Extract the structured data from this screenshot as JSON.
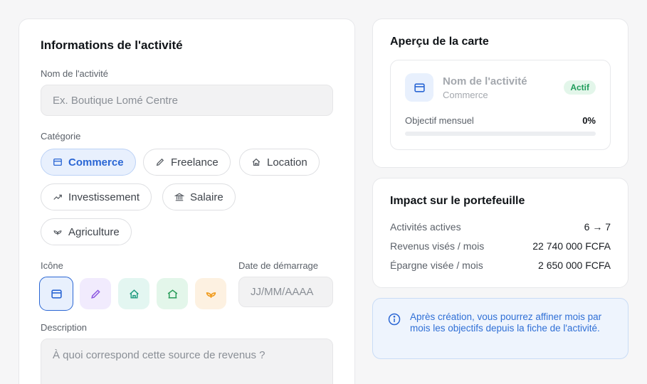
{
  "form": {
    "title": "Informations de l'activité",
    "name_label": "Nom de l'activité",
    "name_placeholder": "Ex. Boutique Lomé Centre",
    "category_label": "Catégorie",
    "categories": [
      {
        "label": "Commerce",
        "icon": "window-icon",
        "active": true
      },
      {
        "label": "Freelance",
        "icon": "pencil-icon",
        "active": false
      },
      {
        "label": "Location",
        "icon": "house-icon",
        "active": false
      },
      {
        "label": "Investissement",
        "icon": "trend-up-icon",
        "active": false
      },
      {
        "label": "Salaire",
        "icon": "bank-icon",
        "active": false
      },
      {
        "label": "Agriculture",
        "icon": "sprout-icon",
        "active": false
      }
    ],
    "icon_label": "Icône",
    "icons": [
      {
        "name": "window-icon",
        "bg": "#e8f0fd",
        "color": "#2a66d4",
        "selected": true
      },
      {
        "name": "pencil-icon",
        "bg": "#f1ebfd",
        "color": "#8b55e0",
        "selected": false
      },
      {
        "name": "house-icon",
        "bg": "#e3f6f1",
        "color": "#1f9c80",
        "selected": false
      },
      {
        "name": "home-outline-icon",
        "bg": "#e3f6ea",
        "color": "#2a9d5a",
        "selected": false
      },
      {
        "name": "sprout-icon",
        "bg": "#fdf1e1",
        "color": "#f09a1a",
        "selected": false
      }
    ],
    "date_label": "Date de démarrage",
    "date_placeholder": "JJ/MM/AAAA",
    "description_label": "Description",
    "description_placeholder": "À quoi correspond cette source de revenus ?"
  },
  "preview": {
    "title": "Aperçu de la carte",
    "name": "Nom de l'activité",
    "category": "Commerce",
    "status": "Actif",
    "goal_label": "Objectif mensuel",
    "goal_value": "0%",
    "progress": 0
  },
  "impact": {
    "title": "Impact sur le portefeuille",
    "rows": [
      {
        "label": "Activités actives",
        "value": "6 → 7"
      },
      {
        "label": "Revenus visés / mois",
        "value": "22 740 000 FCFA"
      },
      {
        "label": "Épargne visée / mois",
        "value": "2 650 000 FCFA"
      }
    ]
  },
  "info": {
    "text": "Après création, vous pourrez affiner mois par mois les objectifs depuis la fiche de l'activité."
  },
  "colors": {
    "accent": "#2a66d4",
    "success": "#1f9c5a",
    "success_bg": "#e3f6ea"
  }
}
